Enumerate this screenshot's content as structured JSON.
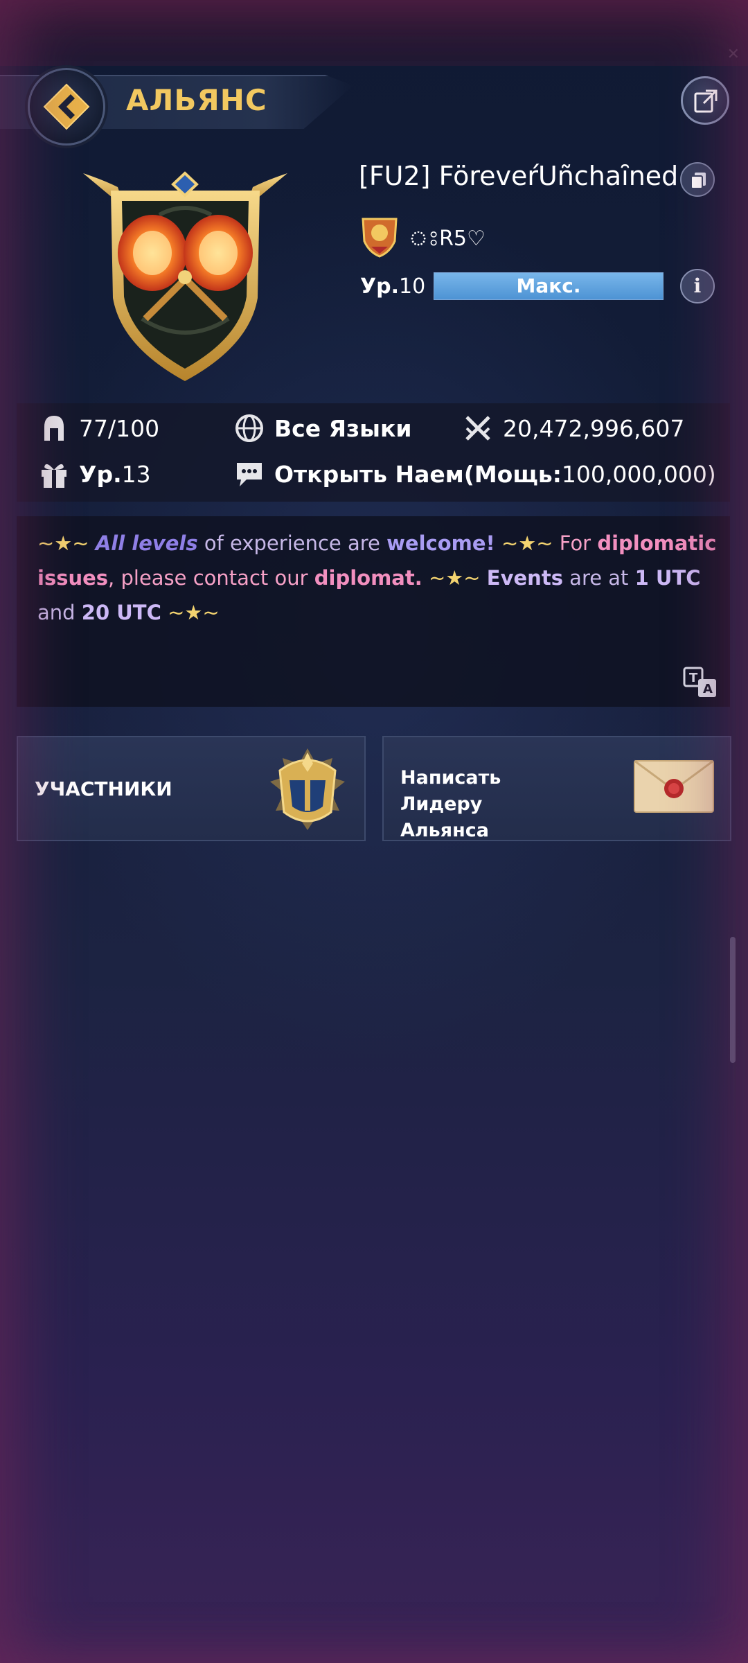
{
  "header": {
    "title": "АЛЬЯНС",
    "back_icon": "back-arrow-icon",
    "share_icon": "share-icon"
  },
  "alliance": {
    "name": "[FU2] FöreveŕUñchaȋned",
    "leader": "ঃR5♡",
    "level_label": "Ур.",
    "level_value": "10",
    "level_progress_text": "Макс.",
    "level_progress": 1.0,
    "emblem_icon": "crossed-axes-shield-icon"
  },
  "stats": {
    "members": "77/100",
    "language": "Все Языки",
    "power": "20,472,996,607",
    "gift_level_prefix": "Ур.",
    "gift_level_value": "13",
    "recruit_label": "Открыть Наем",
    "recruit_power_label": "(Мощь:",
    "recruit_power_value": "100,000,000)"
  },
  "description": {
    "deco": "~★~",
    "p1": "All levels",
    "p2": " of experience are ",
    "p3": "welcome!",
    "p4": " For ",
    "p5": "diplomatic issues",
    "p6": ", please contact our ",
    "p7": "diplomat.",
    "p8": "Events",
    "p9": " are at ",
    "p10": "1 UTC",
    "p11": "and ",
    "p12": "20 UTC"
  },
  "actions": {
    "members_label": "УЧАСТНИКИ",
    "write_leader_label_line1": "Написать Лидеру",
    "write_leader_label_line2": "Альянса"
  },
  "colors": {
    "accent_gold": "#f2c860",
    "progress_blue": "#5fa5e0",
    "panel_bg": "#14182a"
  }
}
